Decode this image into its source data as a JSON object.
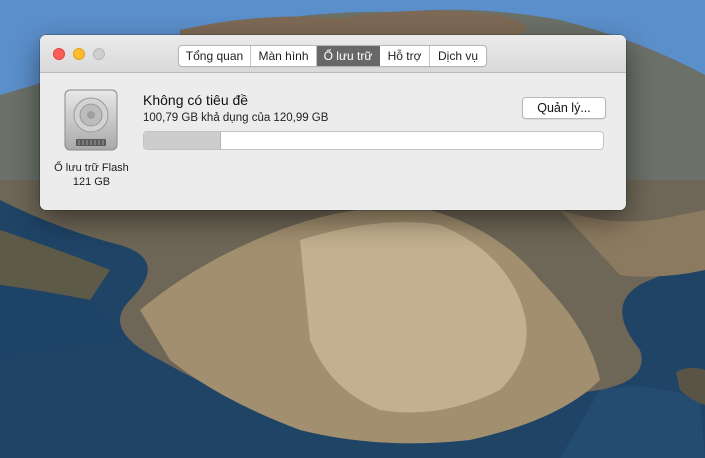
{
  "window": {
    "tabs": [
      {
        "label": "Tổng quan",
        "active": false
      },
      {
        "label": "Màn hình",
        "active": false
      },
      {
        "label": "Ổ lưu trữ",
        "active": true
      },
      {
        "label": "Hỗ trợ",
        "active": false
      },
      {
        "label": "Dịch vụ",
        "active": false
      }
    ]
  },
  "storage": {
    "drive_name": "Ổ lưu trữ Flash",
    "drive_size": "121 GB",
    "volume_name": "Không có tiêu đề",
    "space_text": "100,79 GB khả dụng của 120,99 GB",
    "manage_label": "Quản lý...",
    "used_fraction": 0.167
  },
  "icons": {
    "drive": "hard-drive-icon",
    "close": "close-icon",
    "minimize": "minimize-icon",
    "zoom": "zoom-icon"
  },
  "colors": {
    "close": "#fd5f57",
    "minimize": "#febc2e",
    "zoom_disabled": "#cfcfcf",
    "active_tab": "#686868"
  }
}
